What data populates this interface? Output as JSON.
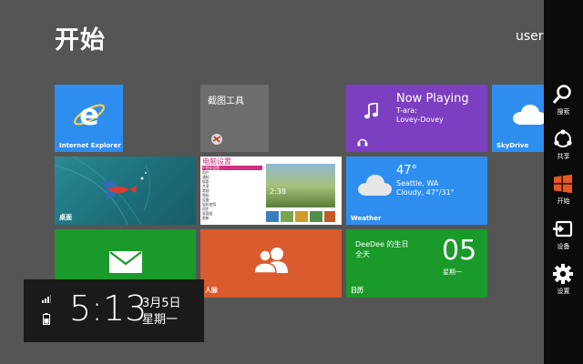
{
  "screen": {
    "title": "开始",
    "user": "user"
  },
  "tiles": {
    "ie": {
      "label": "Internet Explorer",
      "color": "#2d8ef0"
    },
    "snip": {
      "label": "截图工具",
      "color": "#6d6d6d"
    },
    "music": {
      "title": "Now Playing",
      "artist": "T-ara:",
      "track": "Lovey-Dovey",
      "color": "#7d3fc1"
    },
    "skydrive": {
      "label": "SkyDrive",
      "color": "#2d8ef0"
    },
    "desktop": {
      "label": "桌面",
      "color": "#1e7f8a"
    },
    "pcsettings": {
      "header": "电脑设置",
      "menu": [
        "个性化设置",
        "用户",
        "通知",
        "搜索",
        "共享",
        "常规",
        "隐私",
        "设备",
        "轻松使用",
        "同步",
        "家庭组",
        "更新"
      ]
    },
    "weather": {
      "temp": "47°",
      "city": "Seattle, WA",
      "desc": "Cloudy, 47°/31°",
      "label": "Weather",
      "color": "#2d8ef0"
    },
    "mail": {
      "color": "#1a9a2a"
    },
    "people": {
      "label": "人脉",
      "color": "#d95b2e"
    },
    "calendar": {
      "event": "DeeDee 的生日",
      "allday": "全天",
      "day": "05",
      "weekday": "星期一",
      "label": "日历",
      "color": "#1a9a2a"
    }
  },
  "charms": [
    {
      "label": "搜索",
      "icon": "search-icon"
    },
    {
      "label": "共享",
      "icon": "share-icon"
    },
    {
      "label": "开始",
      "icon": "windows-logo-icon",
      "accent": "#e8571b"
    },
    {
      "label": "设备",
      "icon": "devices-icon"
    },
    {
      "label": "设置",
      "icon": "gear-icon"
    }
  ],
  "clock": {
    "time": "5:13",
    "date": "3月5日",
    "weekday": "星期一"
  }
}
